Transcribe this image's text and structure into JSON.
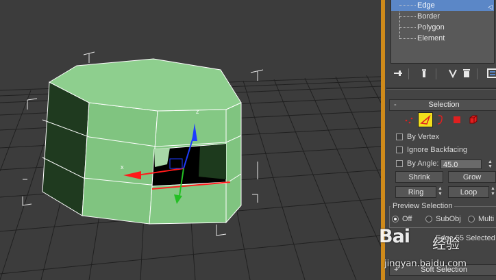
{
  "subobject_list": {
    "items": [
      {
        "label": "Edge",
        "selected": true
      },
      {
        "label": "Border",
        "selected": false
      },
      {
        "label": "Polygon",
        "selected": false
      },
      {
        "label": "Element",
        "selected": false
      }
    ],
    "selected_marker": "◁"
  },
  "toolbar": {
    "icons": [
      "pin-stack-icon",
      "modifier-stack-icon",
      "make-unique-icon",
      "remove-modifier-icon",
      "configure-sets-icon"
    ]
  },
  "selection_rollout": {
    "collapse_symbol": "-",
    "title": "Selection",
    "subobject_modes": [
      {
        "name": "vertex-mode-icon",
        "color": "#e02020",
        "active": false
      },
      {
        "name": "edge-mode-icon",
        "color": "#e02020",
        "active": true
      },
      {
        "name": "border-mode-icon",
        "color": "#e02020",
        "active": false
      },
      {
        "name": "polygon-mode-icon",
        "color": "#e02020",
        "active": false
      },
      {
        "name": "element-mode-icon",
        "color": "#e02020",
        "active": false
      }
    ],
    "by_vertex": "By Vertex",
    "ignore_backfacing": "Ignore Backfacing",
    "by_angle": "By Angle:",
    "angle_value": "45.0",
    "shrink": "Shrink",
    "grow": "Grow",
    "ring": "Ring",
    "loop": "Loop",
    "preview_selection": {
      "title": "Preview Selection",
      "options": [
        "Off",
        "SubObj",
        "Multi"
      ],
      "selected": "Off"
    },
    "status": "Edge 55 Selected"
  },
  "soft_selection_rollout": {
    "expand_symbol": "+",
    "title": "Soft Selection"
  },
  "viewport": {
    "axis_labels": {
      "z": "z",
      "x": "x"
    },
    "object_color": "#86c986"
  },
  "watermark": {
    "logo": "Bai",
    "suffix": "经验",
    "url": "jingyan.baidu.com"
  },
  "colors": {
    "accent_divider": "#cf8a1a",
    "selected_item": "#5b87c7",
    "active_mode": "#f2df1c"
  }
}
